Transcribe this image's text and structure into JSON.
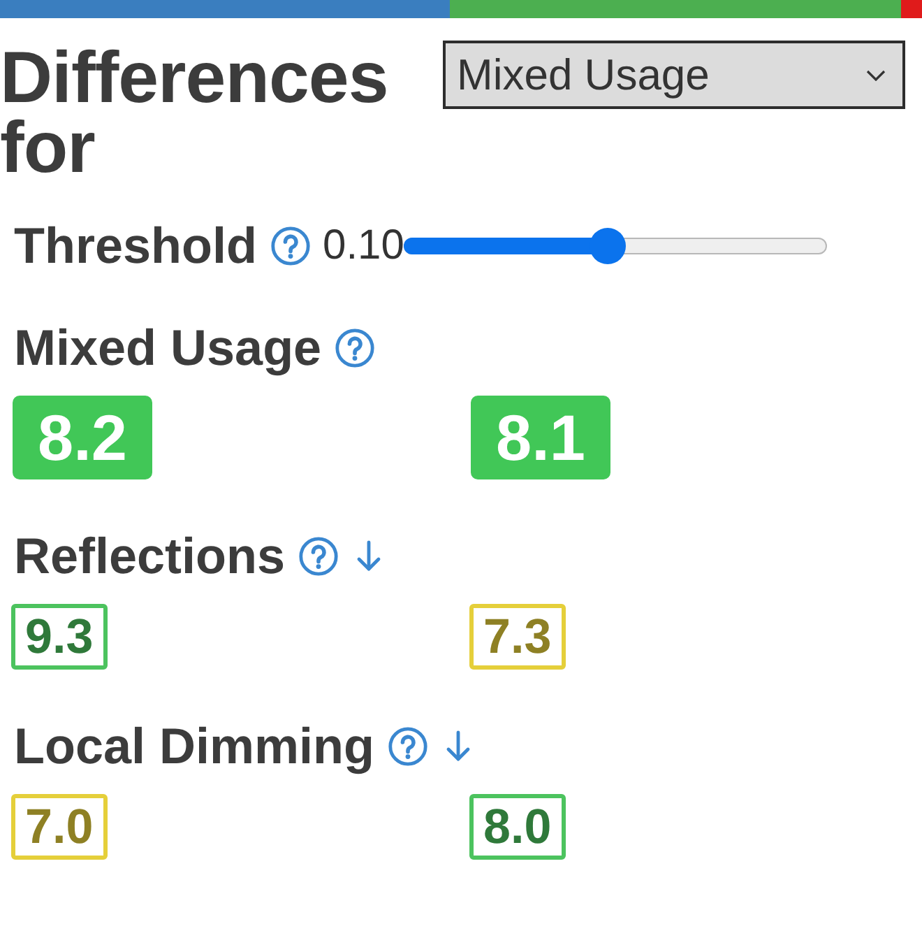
{
  "tabs": [
    {
      "color": "#3a7ebf"
    },
    {
      "color": "#4caf50"
    },
    {
      "color": "#e01b1b"
    }
  ],
  "heading": "Differences for",
  "usage_select": {
    "value": "Mixed Usage"
  },
  "threshold": {
    "label": "Threshold",
    "value": "0.10",
    "level": 0.48
  },
  "sections": [
    {
      "title": "Mixed Usage",
      "sort_arrow": false,
      "scores": [
        {
          "value": "8.2",
          "kind": "filled",
          "color": "#41c757"
        },
        {
          "value": "8.1",
          "kind": "filled",
          "color": "#41c757"
        }
      ]
    },
    {
      "title": "Reflections",
      "sort_arrow": true,
      "scores": [
        {
          "value": "9.3",
          "kind": "outline",
          "color": "#4cc35e"
        },
        {
          "value": "7.3",
          "kind": "outline",
          "color": "#e5cf3a"
        }
      ]
    },
    {
      "title": "Local Dimming",
      "sort_arrow": true,
      "scores": [
        {
          "value": "7.0",
          "kind": "outline",
          "color": "#e5cf3a"
        },
        {
          "value": "8.0",
          "kind": "outline",
          "color": "#4cc35e"
        }
      ]
    }
  ]
}
